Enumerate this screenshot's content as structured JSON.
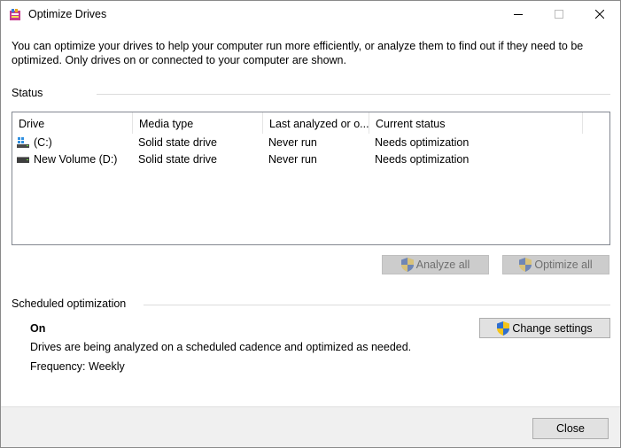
{
  "window": {
    "title": "Optimize Drives",
    "app_icon": "defrag-app-icon"
  },
  "description": "You can optimize your drives to help your computer run more efficiently, or analyze them to find out if they need to be optimized. Only drives on or connected to your computer are shown.",
  "status": {
    "label": "Status",
    "columns": [
      "Drive",
      "Media type",
      "Last analyzed or o...",
      "Current status"
    ],
    "drives": [
      {
        "name": "(C:)",
        "icon": "windows-drive-icon",
        "media_type": "Solid state drive",
        "last_analyzed": "Never run",
        "current_status": "Needs optimization"
      },
      {
        "name": "New Volume (D:)",
        "icon": "drive-icon",
        "media_type": "Solid state drive",
        "last_analyzed": "Never run",
        "current_status": "Needs optimization"
      }
    ],
    "analyze_label": "Analyze all",
    "optimize_label": "Optimize all"
  },
  "scheduled": {
    "label": "Scheduled optimization",
    "state": "On",
    "description": "Drives are being analyzed on a scheduled cadence and optimized as needed.",
    "frequency": "Frequency: Weekly",
    "change_label": "Change settings"
  },
  "footer": {
    "close_label": "Close"
  },
  "colors": {
    "shield_blue": "#2f6fcf",
    "shield_yellow": "#f5c518",
    "disabled_button": "#cccccc",
    "button": "#e1e1e1"
  }
}
